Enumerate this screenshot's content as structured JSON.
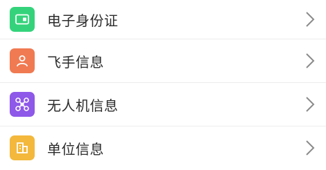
{
  "menu": {
    "items": [
      {
        "label": "电子身份证",
        "icon": "id-card-icon",
        "color": "#34d37b"
      },
      {
        "label": "飞手信息",
        "icon": "person-icon",
        "color": "#f07a52"
      },
      {
        "label": "无人机信息",
        "icon": "drone-icon",
        "color": "#8e58e8"
      },
      {
        "label": "单位信息",
        "icon": "building-icon",
        "color": "#f3b83c"
      }
    ],
    "chevron_icon": "chevron-right-icon"
  }
}
